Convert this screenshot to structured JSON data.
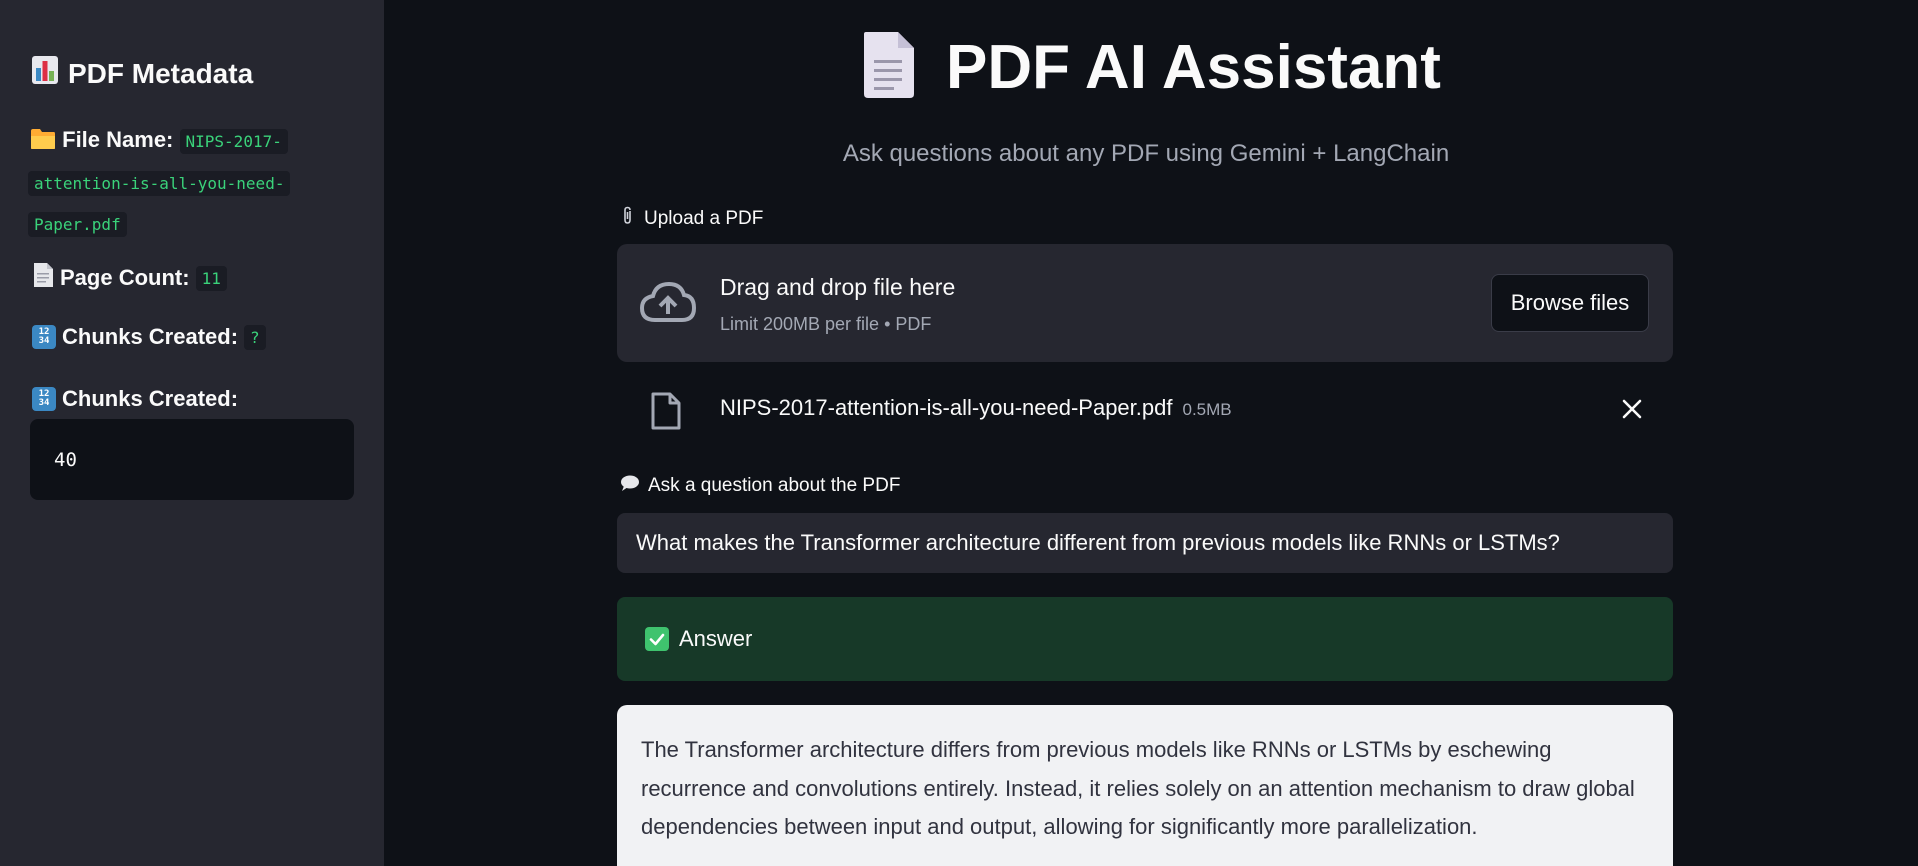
{
  "sidebar": {
    "title": "PDF Metadata",
    "file_name_label": "File Name:",
    "file_name_value": "NIPS-2017-attention-is-all-you-need-Paper.pdf",
    "file_name_parts": [
      "NIPS-2017-",
      "attention-is-all-you-need-",
      "Paper.pdf"
    ],
    "page_count_label": "Page Count:",
    "page_count_value": "11",
    "chunks_label_1": "Chunks Created:",
    "chunks_value_1": "?",
    "chunks_label_2": "Chunks Created:",
    "chunks_value_2": "40",
    "icons": {
      "title": "bar-chart-icon",
      "file_name": "folder-icon",
      "page_count": "page-icon",
      "chunks": "input-numbers-icon"
    }
  },
  "main": {
    "title": "PDF AI Assistant",
    "title_icon": "document-icon",
    "subtitle": "Ask questions about any PDF using Gemini + LangChain",
    "upload": {
      "label": "Upload a PDF",
      "label_icon": "paperclip-icon",
      "drop_text": "Drag and drop file here",
      "limit_text": "Limit 200MB per file • PDF",
      "browse_label": "Browse files",
      "upload_icon": "cloud-upload-icon"
    },
    "uploaded_file": {
      "name": "NIPS-2017-attention-is-all-you-need-Paper.pdf",
      "size": "0.5MB"
    },
    "question": {
      "label": "Ask a question about the PDF",
      "label_icon": "speech-bubble-icon",
      "value": "What makes the Transformer architecture different from previous models like RNNs or LSTMs?"
    },
    "answer": {
      "label": "Answer",
      "label_icon": "check-mark-icon",
      "text": "The Transformer architecture differs from previous models like RNNs or LSTMs by eschewing recurrence and convolutions entirely. Instead, it relies solely on an attention mechanism to draw global dependencies between input and output, allowing for significantly more parallelization."
    }
  },
  "colors": {
    "background": "#0e1117",
    "sidebar": "#262730",
    "code_green": "#3ad27a",
    "success_bg": "#173928",
    "answer_card": "#f1f2f4"
  }
}
